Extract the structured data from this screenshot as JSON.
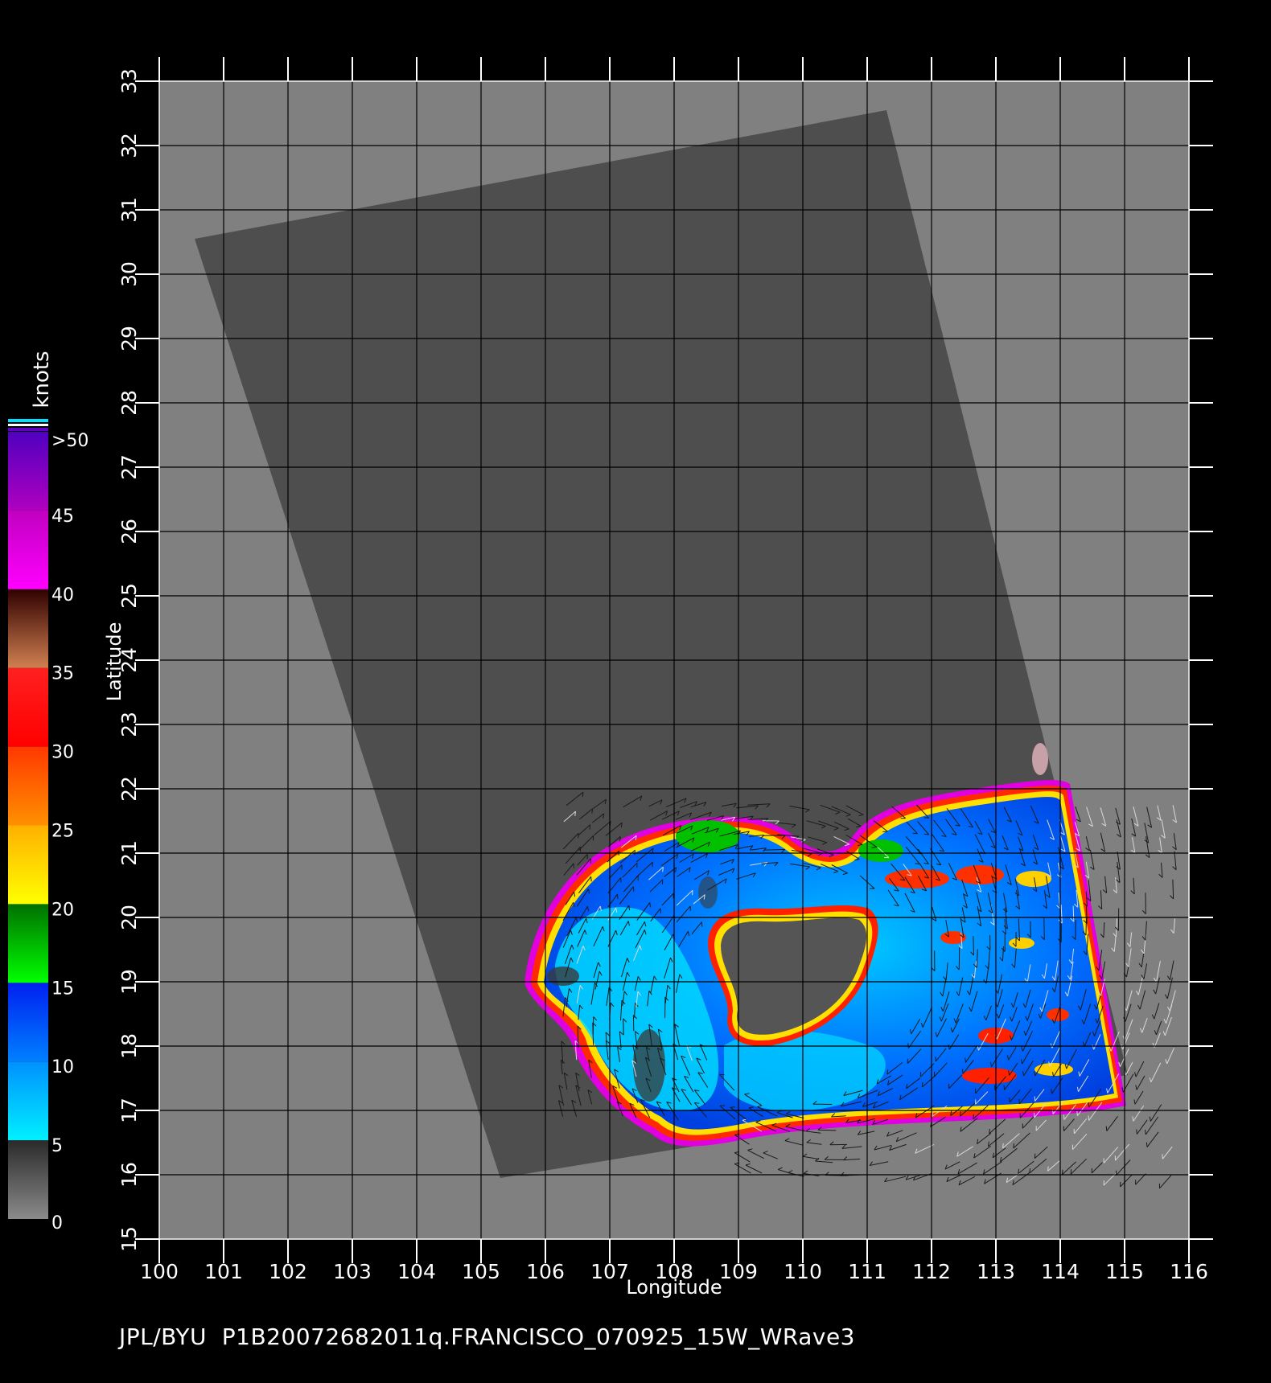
{
  "map": {
    "x_axis": {
      "label": "Longitude",
      "min": 100,
      "max": 116,
      "ticks": [
        100,
        101,
        102,
        103,
        104,
        105,
        106,
        107,
        108,
        109,
        110,
        111,
        112,
        113,
        114,
        115,
        116
      ]
    },
    "y_axis": {
      "label": "Latitude",
      "min": 15,
      "max": 33,
      "ticks": [
        15,
        16,
        17,
        18,
        19,
        20,
        21,
        22,
        23,
        24,
        25,
        26,
        27,
        28,
        29,
        30,
        31,
        32,
        33
      ]
    },
    "swath_corners_lonlat": [
      [
        100.55,
        30.55
      ],
      [
        111.3,
        32.55
      ],
      [
        115.05,
        17.55
      ],
      [
        105.3,
        15.95
      ]
    ],
    "storm_eye_center_lonlat": [
      110.0,
      18.95
    ],
    "background_color": "#808080",
    "swath_color": "#4e4e4e",
    "grid": true
  },
  "colorbar": {
    "title": "knots",
    "labels": [
      "0",
      "5",
      "10",
      "15",
      "20",
      "25",
      "30",
      "35",
      "40",
      "45",
      ">50"
    ],
    "segments": [
      {
        "from": 0,
        "to": 5,
        "colors": [
          "#8a8a8a",
          "#2a2a2a"
        ]
      },
      {
        "from": 5,
        "to": 10,
        "colors": [
          "#00f0ff",
          "#0090ff"
        ]
      },
      {
        "from": 10,
        "to": 15,
        "colors": [
          "#0080ff",
          "#0020f0"
        ]
      },
      {
        "from": 15,
        "to": 20,
        "colors": [
          "#00ff00",
          "#007000"
        ]
      },
      {
        "from": 20,
        "to": 25,
        "colors": [
          "#ffff00",
          "#ffb000"
        ]
      },
      {
        "from": 25,
        "to": 30,
        "colors": [
          "#ff9000",
          "#ff3800"
        ]
      },
      {
        "from": 30,
        "to": 35,
        "colors": [
          "#ff0000",
          "#ff2020"
        ]
      },
      {
        "from": 35,
        "to": 40,
        "colors": [
          "#d08050",
          "#300000"
        ]
      },
      {
        "from": 40,
        "to": 45,
        "colors": [
          "#ff00ff",
          "#c000c0"
        ]
      },
      {
        "from": 45,
        "to": 50,
        "colors": [
          "#b000c0",
          "#5000c0"
        ]
      }
    ]
  },
  "caption": "JPL/BYU  P1B20072682011q.FRANCISCO_070925_15W_WRave3"
}
